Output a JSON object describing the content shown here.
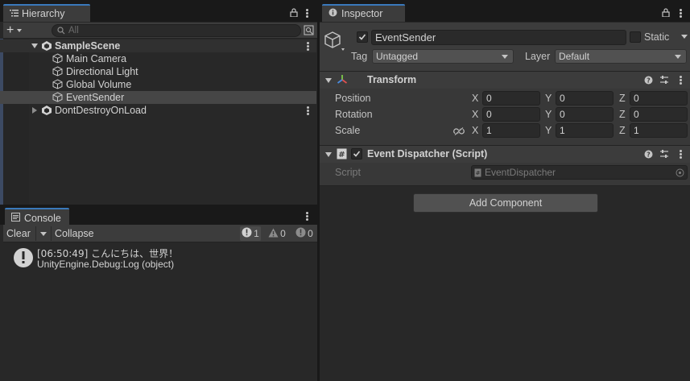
{
  "hierarchy": {
    "tab_label": "Hierarchy",
    "search_placeholder": "All",
    "scene": "SampleScene",
    "items": [
      {
        "label": "Main Camera"
      },
      {
        "label": "Directional Light"
      },
      {
        "label": "Global Volume"
      },
      {
        "label": "EventSender"
      }
    ],
    "dont_destroy": "DontDestroyOnLoad"
  },
  "console": {
    "tab_label": "Console",
    "clear_label": "Clear",
    "collapse_label": "Collapse",
    "log_count": "1",
    "warn_count": "0",
    "error_count": "0",
    "entries": [
      {
        "line1": "[06:50:49] こんにちは、世界！",
        "line2": "UnityEngine.Debug:Log (object)"
      }
    ]
  },
  "inspector": {
    "tab_label": "Inspector",
    "object_name": "EventSender",
    "static_label": "Static",
    "tag_label": "Tag",
    "tag_value": "Untagged",
    "layer_label": "Layer",
    "layer_value": "Default",
    "transform": {
      "title": "Transform",
      "position_label": "Position",
      "rotation_label": "Rotation",
      "scale_label": "Scale",
      "x_label": "X",
      "y_label": "Y",
      "z_label": "Z",
      "position": {
        "x": "0",
        "y": "0",
        "z": "0"
      },
      "rotation": {
        "x": "0",
        "y": "0",
        "z": "0"
      },
      "scale": {
        "x": "1",
        "y": "1",
        "z": "1"
      }
    },
    "script_component": {
      "title": "Event Dispatcher (Script)",
      "script_label": "Script",
      "script_value": "EventDispatcher"
    },
    "add_component_label": "Add Component"
  },
  "colors": {
    "accent": "#3a79bb",
    "selected_row": "#464646",
    "panel_bg": "#383838"
  }
}
